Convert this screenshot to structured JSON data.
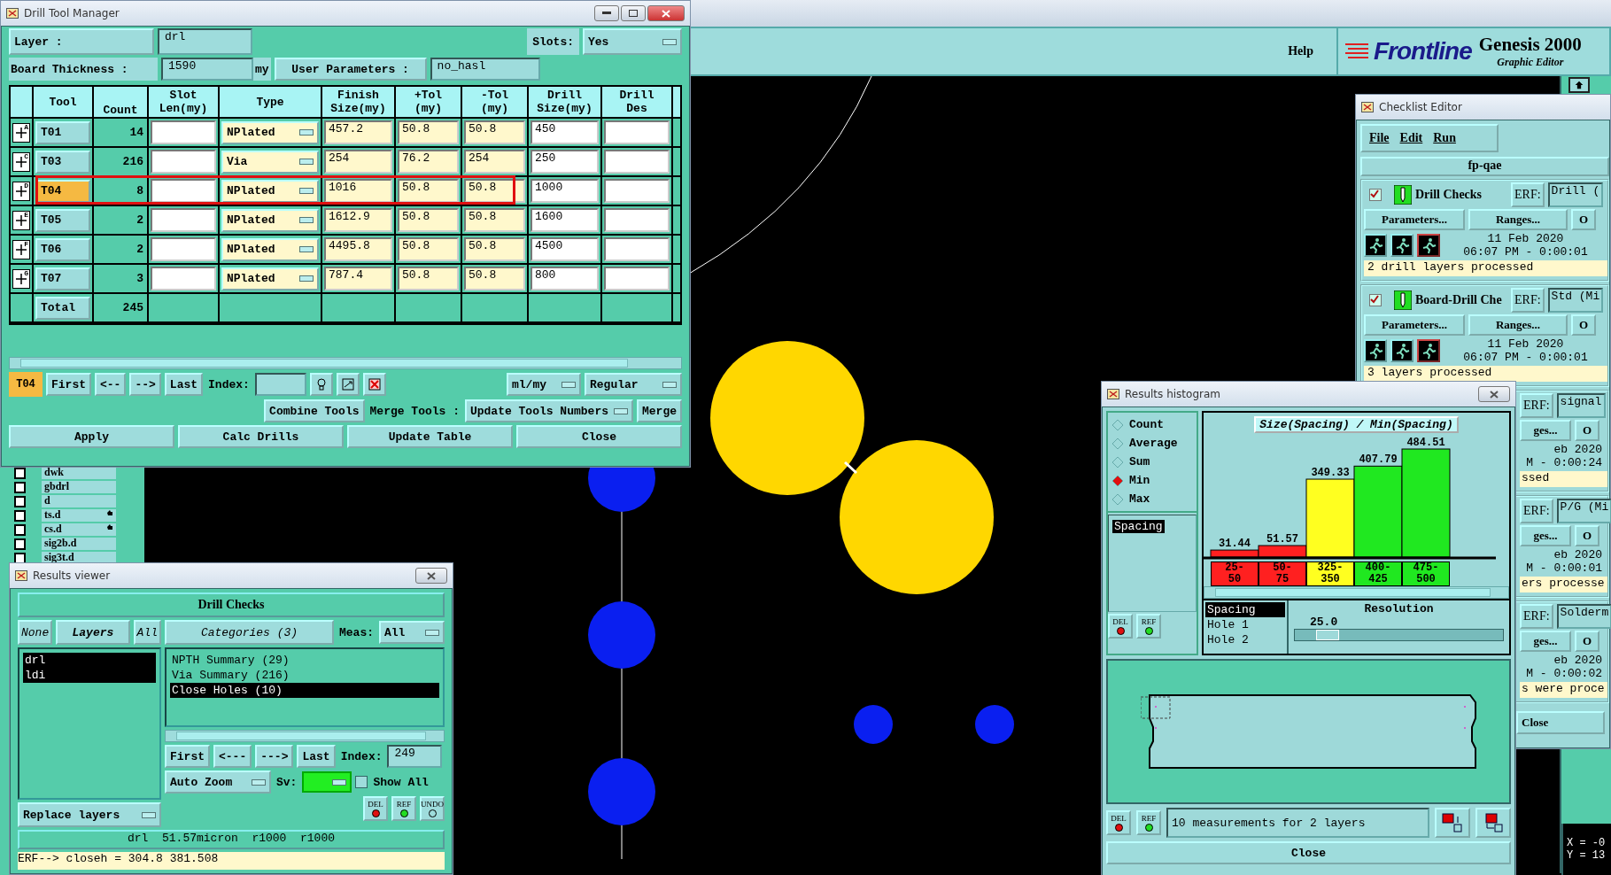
{
  "app_header": {
    "help": "Help",
    "logo": "Frontline",
    "product": "Genesis 2000",
    "subtitle": "Graphic Editor"
  },
  "layer_list": [
    {
      "name": "dwk",
      "checked": false,
      "flagged": false
    },
    {
      "name": "gbdrl",
      "checked": false,
      "flagged": false
    },
    {
      "name": "d",
      "checked": false,
      "flagged": false
    },
    {
      "name": "ts.d",
      "checked": false,
      "flagged": true
    },
    {
      "name": "cs.d",
      "checked": false,
      "flagged": true
    },
    {
      "name": "sig2b.d",
      "checked": false,
      "flagged": false
    },
    {
      "name": "sig3t.d",
      "checked": false,
      "flagged": false
    }
  ],
  "coordinates": [
    "X = -0",
    "Y = 13"
  ],
  "drill_tool_manager": {
    "title": "Drill Tool Manager",
    "layer_button": "Layer      :",
    "layer_value": "drl",
    "slots_label": "Slots:",
    "slots_value": "Yes",
    "thickness_label": "Board Thickness :",
    "thickness_value": "1590",
    "thickness_unit": "my",
    "user_params_button": "User Parameters :",
    "user_params_value": "no_hasl",
    "columns": [
      [
        "Tool"
      ],
      [
        "Count"
      ],
      [
        "Slot",
        "Len(my)"
      ],
      [
        "Type"
      ],
      [
        "Finish",
        "Size(my)"
      ],
      [
        "+Tol",
        "(my)"
      ],
      [
        "-Tol",
        "(my)"
      ],
      [
        "Drill",
        "Size(my)"
      ],
      [
        "Drill",
        "Des"
      ]
    ],
    "rows": [
      {
        "marker": "A",
        "tool": "T01",
        "count": "14",
        "type": "NPlated",
        "finish": "457.2",
        "plus_tol": "50.8",
        "minus_tol": "50.8",
        "drill_size": "450",
        "selected": false
      },
      {
        "marker": "C",
        "tool": "T03",
        "count": "216",
        "type": "Via",
        "finish": "254",
        "plus_tol": "76.2",
        "minus_tol": "254",
        "drill_size": "250",
        "selected": false
      },
      {
        "marker": "D",
        "tool": "T04",
        "count": "8",
        "type": "NPlated",
        "finish": "1016",
        "plus_tol": "50.8",
        "minus_tol": "50.8",
        "drill_size": "1000",
        "selected": true
      },
      {
        "marker": "E",
        "tool": "T05",
        "count": "2",
        "type": "NPlated",
        "finish": "1612.9",
        "plus_tol": "50.8",
        "minus_tol": "50.8",
        "drill_size": "1600",
        "selected": false
      },
      {
        "marker": "F",
        "tool": "T06",
        "count": "2",
        "type": "NPlated",
        "finish": "4495.8",
        "plus_tol": "50.8",
        "minus_tol": "50.8",
        "drill_size": "4500",
        "selected": false
      },
      {
        "marker": "G",
        "tool": "T07",
        "count": "3",
        "type": "NPlated",
        "finish": "787.4",
        "plus_tol": "50.8",
        "minus_tol": "50.8",
        "drill_size": "800",
        "selected": false
      }
    ],
    "total_label": "Total",
    "total_count": "245",
    "current_tool": "T04",
    "nav_buttons": [
      "First",
      "<--",
      "-->",
      "Last"
    ],
    "index_label": "Index:",
    "units": "ml/my",
    "mode": "Regular",
    "combine": "Combine Tools",
    "merge_label": "Merge Tools :",
    "merge_mode": "Update Tools Numbers",
    "merge": "Merge",
    "actions": [
      "Apply",
      "Calc Drills",
      "Update Table",
      "Close"
    ]
  },
  "results_viewer": {
    "title": "Results viewer",
    "heading": "Drill Checks",
    "filters": [
      "None",
      "Layers",
      "All"
    ],
    "layers": [
      {
        "name": "drl",
        "selected": true
      },
      {
        "name": "ldi",
        "selected": true
      }
    ],
    "categories_button": "Categories (3)",
    "meas_label": "Meas:",
    "meas_value": "All",
    "categories": [
      {
        "label": "NPTH Summary (29)",
        "selected": false
      },
      {
        "label": "Via Summary (216)",
        "selected": false
      },
      {
        "label": "Close Holes (10)",
        "selected": true
      }
    ],
    "nav_buttons": [
      "First",
      "<---",
      "--->",
      "Last"
    ],
    "index_label": "Index:",
    "index_value": "249",
    "zoom": "Auto Zoom",
    "sv_label": "Sv:",
    "show_all": {
      "label": "Show All",
      "checked": false
    },
    "replace": "Replace layers",
    "tools": [
      "DEL",
      "REF",
      "UNDO"
    ],
    "status": "drl  51.57micron  r1000  r1000",
    "erf": "ERF--> closeh = 304.8 381.508"
  },
  "checklist_editor": {
    "title": "Checklist Editor",
    "menu": [
      "File",
      "Edit",
      "Run"
    ],
    "name": "fp-qae",
    "checks": [
      {
        "kind": "full",
        "enabled": true,
        "name": "Drill Checks",
        "erf_label": "ERF:",
        "erf_value": "Drill (",
        "buttons": [
          "Parameters...",
          "Ranges...",
          "O"
        ],
        "date": "11 Feb 2020",
        "time": "06:07 PM - 0:00:01",
        "message": "2 drill layers processed"
      },
      {
        "kind": "full",
        "enabled": true,
        "name": "Board-Drill Che",
        "erf_label": "ERF:",
        "erf_value": "Std (Mi",
        "buttons": [
          "Parameters...",
          "Ranges...",
          "O"
        ],
        "date": "11 Feb 2020",
        "time": "06:07 PM - 0:00:01",
        "message": "3 layers processed"
      },
      {
        "kind": "partial",
        "erf_label": "ERF:",
        "erf_value": "signal",
        "buttons": [
          "ges...",
          "O"
        ],
        "date": "eb 2020",
        "time": "M - 0:00:24",
        "message": "ssed"
      },
      {
        "kind": "partial",
        "erf_label": "ERF:",
        "erf_value": "P/G (Mi",
        "buttons": [
          "ges...",
          "O"
        ],
        "date": "eb 2020",
        "time": "M - 0:00:01",
        "message": "ers processe"
      },
      {
        "kind": "partial",
        "erf_label": "ERF:",
        "erf_value": "Solderm",
        "buttons": [
          "ges...",
          "O"
        ],
        "date": "eb 2020",
        "time": "M - 0:00:02",
        "message": "s were proce"
      }
    ],
    "close": "Close"
  },
  "results_histogram": {
    "title": "Results histogram",
    "modes": [
      {
        "label": "Count",
        "selected": false
      },
      {
        "label": "Average",
        "selected": false
      },
      {
        "label": "Sum",
        "selected": false
      },
      {
        "label": "Min",
        "selected": true
      },
      {
        "label": "Max",
        "selected": false
      }
    ],
    "attributes": [
      {
        "label": "Spacing",
        "selected": true
      }
    ],
    "chart_data": {
      "type": "bar",
      "title": "Size(Spacing) / Min(Spacing)",
      "categories": [
        "25-50",
        "50-75",
        "325-350",
        "400-425",
        "475-500"
      ],
      "values": [
        31.44,
        51.57,
        349.33,
        407.79,
        484.51
      ],
      "data_labels": true
    },
    "bins": [
      {
        "color": "#ff2020"
      },
      {
        "color": "#ff2020"
      },
      {
        "color": "#ffff20"
      },
      {
        "color": "#20e820"
      },
      {
        "color": "#20e820"
      }
    ],
    "fields": [
      {
        "label": "Spacing",
        "selected": true
      },
      {
        "label": "Hole 1",
        "selected": false
      },
      {
        "label": "Hole 2",
        "selected": false
      }
    ],
    "resolution_label": "Resolution",
    "resolution_value": "25.0",
    "resolution": {
      "level": 0.12
    },
    "tools": [
      "DEL",
      "REF"
    ],
    "footer_tools": [
      "DEL",
      "REF"
    ],
    "summary": "10 measurements for 2 layers",
    "close": "Close"
  }
}
